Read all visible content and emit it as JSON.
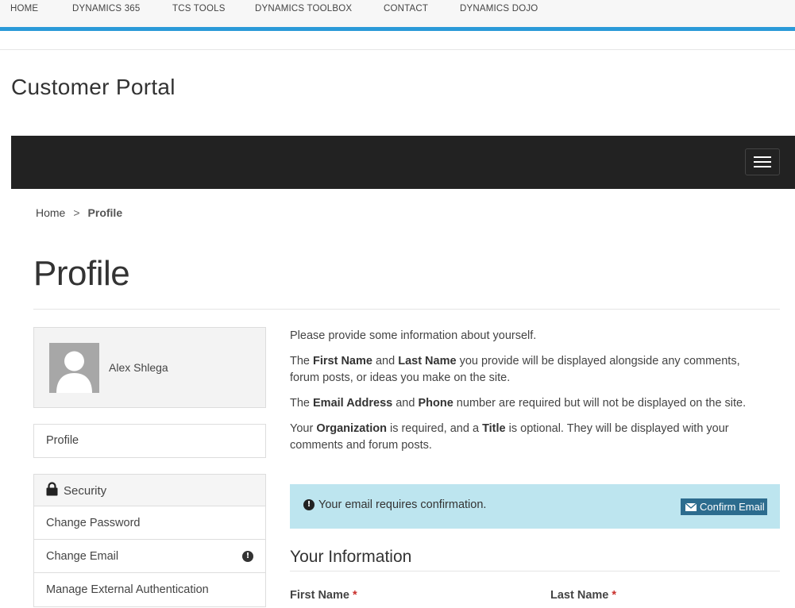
{
  "topnav": {
    "items": [
      "HOME",
      "DYNAMICS 365",
      "TCS TOOLS",
      "DYNAMICS TOOLBOX",
      "CONTACT",
      "DYNAMICS DOJO"
    ],
    "accent_color": "#2b9ad8"
  },
  "portal_title": "Customer Portal",
  "breadcrumb": {
    "home": "Home",
    "separator": ">",
    "current": "Profile"
  },
  "page_title": "Profile",
  "profile_card": {
    "name": "Alex Shlega"
  },
  "side_menu": {
    "profile_link": "Profile",
    "security_header": "Security",
    "security_items": [
      "Change Password",
      "Change Email",
      "Manage External Authentication"
    ]
  },
  "intro": {
    "p1": "Please provide some information about yourself.",
    "p2": {
      "t1": "The ",
      "b1": "First Name",
      "t2": " and ",
      "b2": "Last Name",
      "t3": " you provide will be displayed alongside any comments, forum posts, or ideas you make on the site."
    },
    "p3": {
      "t1": "The ",
      "b1": "Email Address",
      "t2": " and ",
      "b2": "Phone",
      "t3": " number are required but will not be displayed on the site."
    },
    "p4": {
      "t1": "Your ",
      "b1": "Organization",
      "t2": " is required, and a ",
      "b2": "Title",
      "t3": " is optional. They will be displayed with your comments and forum posts."
    }
  },
  "alert": {
    "message": "Your email requires confirmation.",
    "button_label": "Confirm Email",
    "background": "#bde5ef",
    "button_color": "#2c6c8e"
  },
  "your_information": {
    "title": "Your Information",
    "first_name_label": "First Name",
    "last_name_label": "Last Name",
    "required_marker": "*"
  }
}
